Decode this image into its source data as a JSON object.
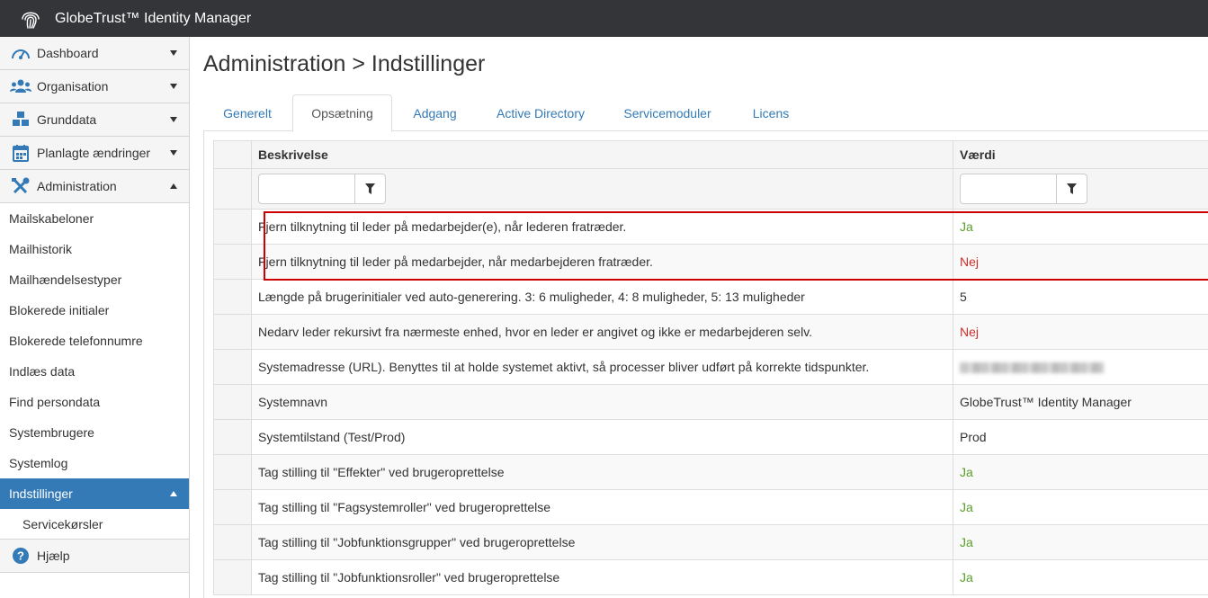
{
  "app": {
    "title": "GlobeTrust™ Identity Manager",
    "logo_icon": "fingerprint-icon"
  },
  "sidebar": {
    "nav": [
      {
        "label": "Dashboard",
        "icon": "dashboard-icon",
        "expanded": false
      },
      {
        "label": "Organisation",
        "icon": "users-icon",
        "expanded": false
      },
      {
        "label": "Grunddata",
        "icon": "cubes-icon",
        "expanded": false
      },
      {
        "label": "Planlagte ændringer",
        "icon": "calendar-icon",
        "expanded": false
      },
      {
        "label": "Administration",
        "icon": "wrench-icon",
        "expanded": true
      }
    ],
    "admin_items": [
      "Mailskabeloner",
      "Mailhistorik",
      "Mailhændelsestyper",
      "Blokerede initialer",
      "Blokerede telefonnumre",
      "Indlæs data",
      "Find persondata",
      "Systembrugere",
      "Systemlog"
    ],
    "active_item": "Indstillinger",
    "active_sub_item": "Servicekørsler",
    "help": {
      "label": "Hjælp",
      "icon": "question-circle-icon"
    }
  },
  "main": {
    "title": "Administration > Indstillinger",
    "tabs": [
      "Generelt",
      "Opsætning",
      "Adgang",
      "Active Directory",
      "Servicemoduler",
      "Licens"
    ],
    "active_tab": "Opsætning",
    "table": {
      "headers": {
        "description": "Beskrivelse",
        "value": "Værdi"
      },
      "filters": {
        "description": "",
        "value": ""
      },
      "rows": [
        {
          "description": "Fjern tilknytning til leder på medarbejder(e), når lederen fratræder.",
          "value": "Ja",
          "kind": "ja"
        },
        {
          "description": "Fjern tilknytning til leder på medarbejder, når medarbejderen fratræder.",
          "value": "Nej",
          "kind": "nej"
        },
        {
          "description": "Længde på brugerinitialer ved auto-generering. 3: 6 muligheder, 4: 8 muligheder, 5: 13 muligheder",
          "value": "5",
          "kind": "text"
        },
        {
          "description": "Nedarv leder rekursivt fra nærmeste enhed, hvor en leder er angivet og ikke er medarbejderen selv.",
          "value": "Nej",
          "kind": "nej"
        },
        {
          "description": "Systemadresse (URL). Benyttes til at holde systemet aktivt, så processer bliver udført på korrekte tidspunkter.",
          "value": "",
          "kind": "blurred"
        },
        {
          "description": "Systemnavn",
          "value": "GlobeTrust™ Identity Manager",
          "kind": "text"
        },
        {
          "description": "Systemtilstand (Test/Prod)",
          "value": "Prod",
          "kind": "text"
        },
        {
          "description": "Tag stilling til \"Effekter\" ved brugeroprettelse",
          "value": "Ja",
          "kind": "ja"
        },
        {
          "description": "Tag stilling til \"Fagsystemroller\" ved brugeroprettelse",
          "value": "Ja",
          "kind": "ja"
        },
        {
          "description": "Tag stilling til \"Jobfunktionsgrupper\" ved brugeroprettelse",
          "value": "Ja",
          "kind": "ja"
        },
        {
          "description": "Tag stilling til \"Jobfunktionsroller\" ved brugeroprettelse",
          "value": "Ja",
          "kind": "ja"
        }
      ]
    }
  },
  "colors": {
    "topbar": "#333538",
    "active": "#337ab7",
    "link": "#337ab7",
    "ja": "#5aa02c",
    "nej": "#c9302c",
    "highlight": "#cc0000"
  }
}
